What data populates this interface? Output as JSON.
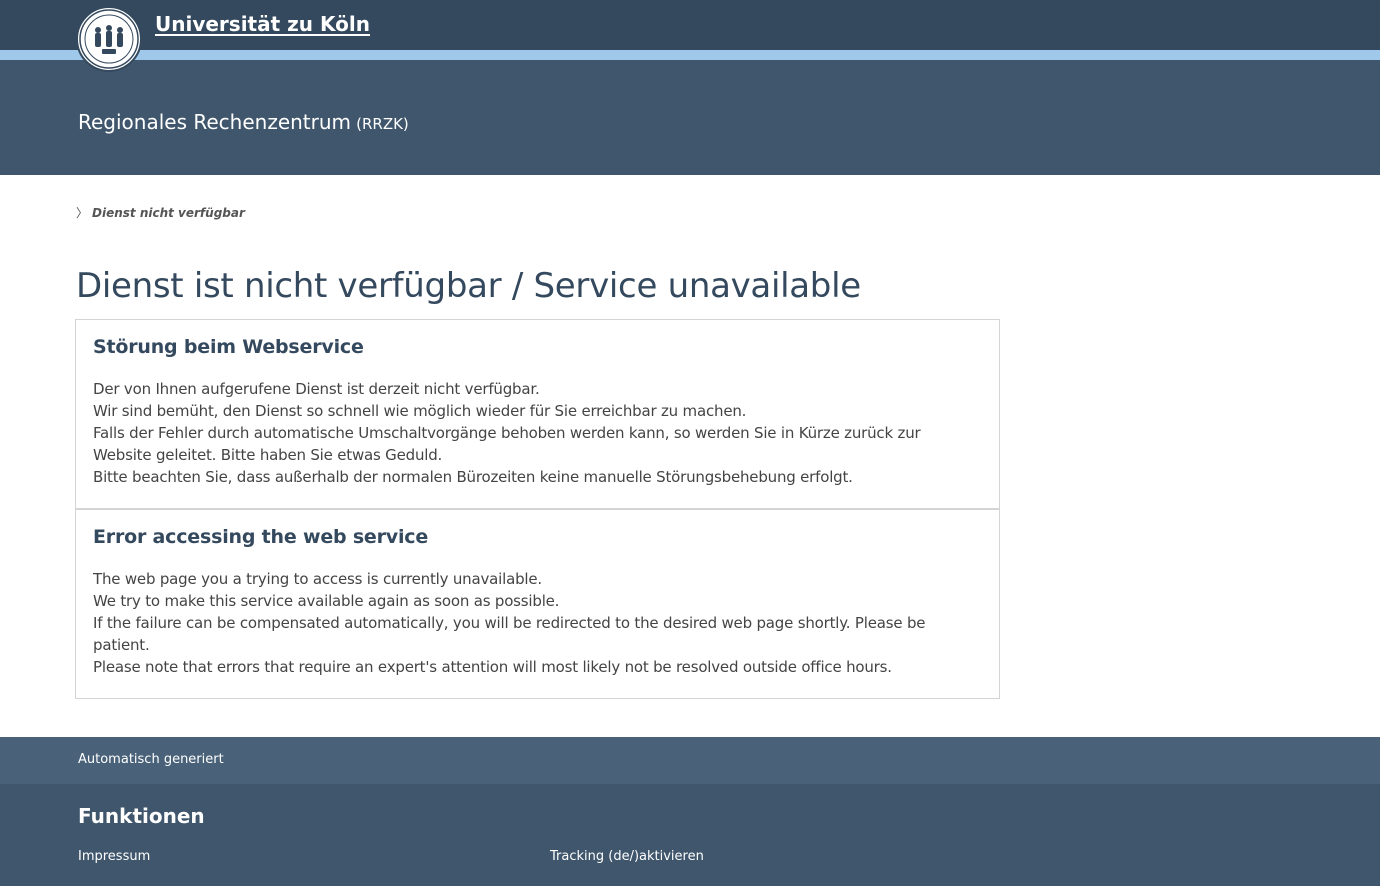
{
  "header": {
    "university_name": "Universität zu Köln",
    "logo_icon": "university-seal-icon",
    "subunit_name": "Regionales Rechenzentrum",
    "subunit_abbr": "(RRZK)"
  },
  "breadcrumb": {
    "current": "Dienst nicht verfügbar"
  },
  "page_title": "Dienst ist nicht verfügbar / Service unavailable",
  "panels": [
    {
      "heading": "Störung beim Webservice",
      "lines": [
        "Der von Ihnen aufgerufene Dienst ist derzeit nicht verfügbar.",
        "Wir sind bemüht, den Dienst so schnell wie möglich wieder für Sie erreichbar zu machen.",
        "Falls der Fehler durch automatische Umschaltvorgänge behoben werden kann, so werden Sie in Kürze zurück zur Website geleitet. Bitte haben Sie etwas Geduld.",
        "Bitte beachten Sie, dass außerhalb der normalen Bürozeiten keine manuelle Störungsbehebung erfolgt."
      ]
    },
    {
      "heading": "Error accessing the web service",
      "lines": [
        "The web page you a trying to access is currently unavailable.",
        "We try to make this service available again as soon as possible.",
        "If the failure can be compensated automatically, you will be redirected to the desired web page shortly. Please be patient.",
        "Please note that errors that require an expert's attention will most likely not be resolved outside office hours."
      ]
    }
  ],
  "footer": {
    "generated_note": "Automatisch generiert",
    "functions_heading": "Funktionen",
    "links": {
      "impressum": "Impressum",
      "tracking": "Tracking (de/)aktivieren"
    }
  },
  "colors": {
    "header_dark": "#34495e",
    "header_stripe": "#9fc8ea",
    "header_band": "#3f566c",
    "footer_strip": "#4a6279",
    "title_color": "#34495e"
  }
}
